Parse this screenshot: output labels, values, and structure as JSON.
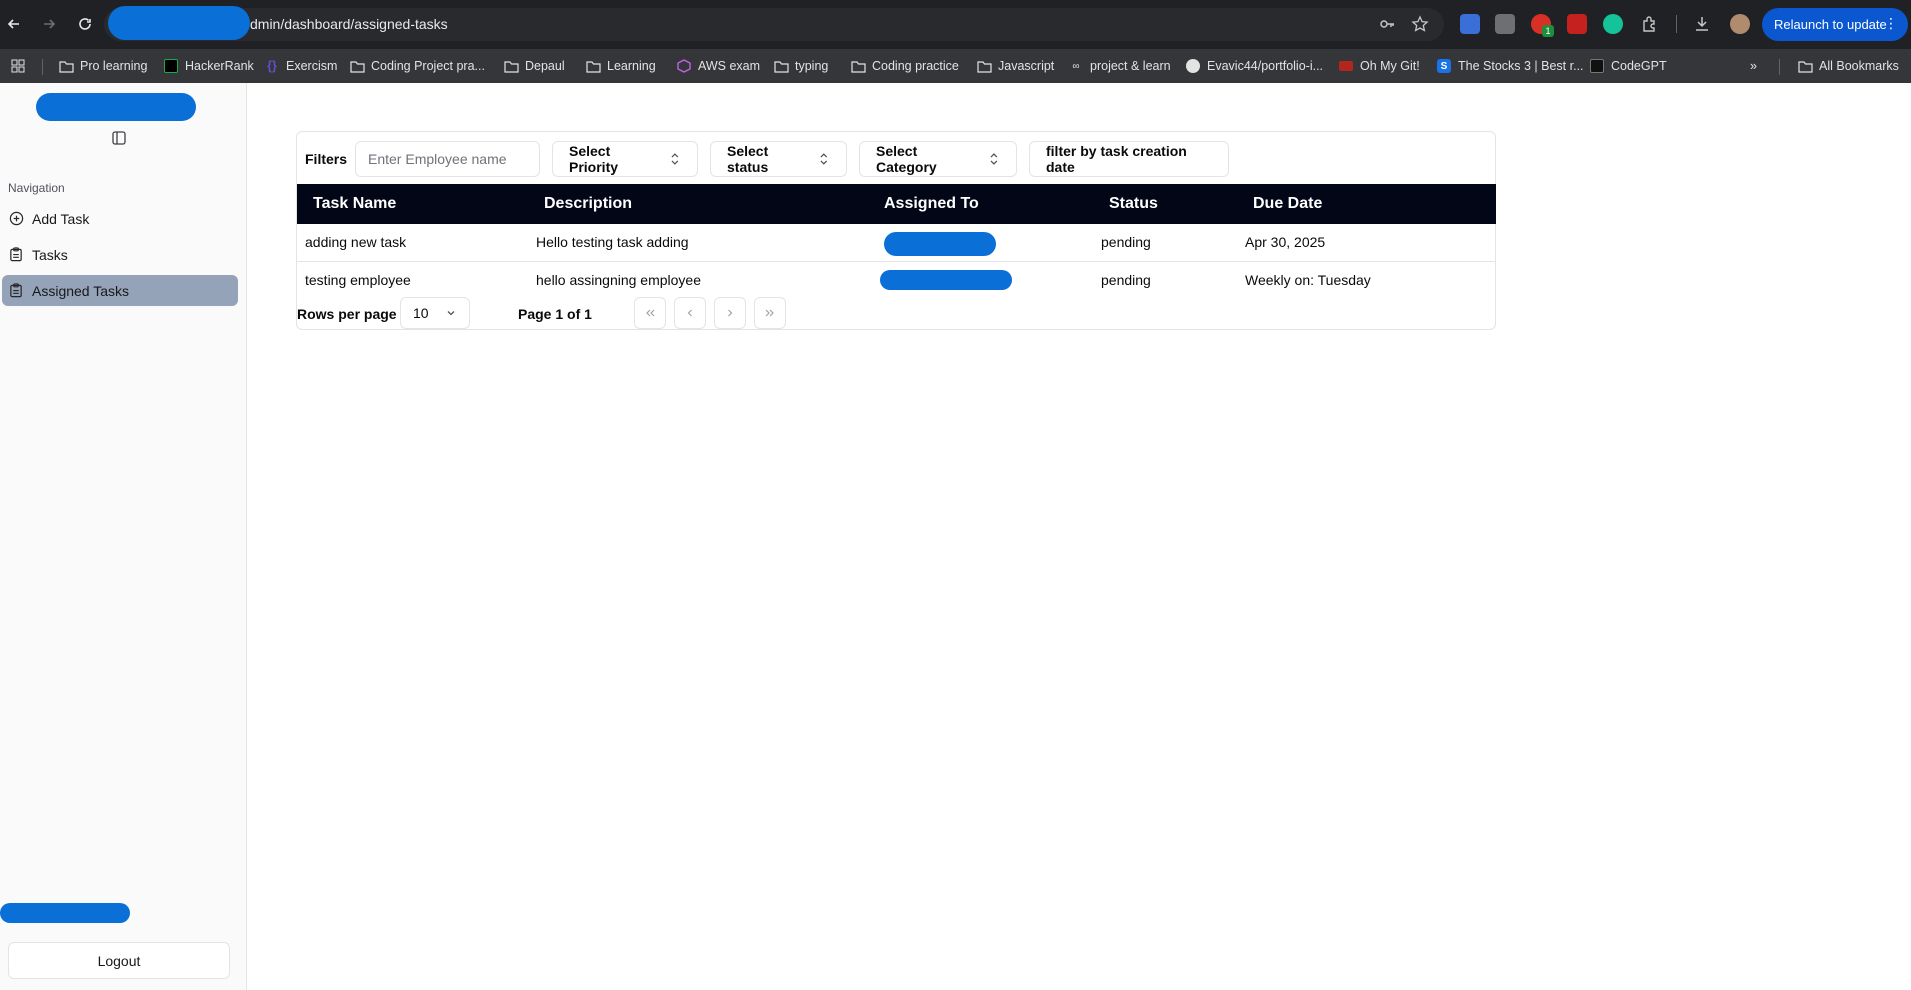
{
  "browser": {
    "url": "dmin/dashboard/assigned-tasks",
    "relaunch_label": "Relaunch to update",
    "extension_badge": "1",
    "bookmarks": [
      {
        "label": "Pro learning",
        "icon": "folder-icon"
      },
      {
        "label": "HackerRank",
        "icon": "hackerrank-icon"
      },
      {
        "label": "Exercism",
        "icon": "exercism-icon"
      },
      {
        "label": "Coding Project pra...",
        "icon": "folder-icon"
      },
      {
        "label": "Depaul",
        "icon": "folder-icon"
      },
      {
        "label": "Learning",
        "icon": "folder-icon"
      },
      {
        "label": "AWS exam",
        "icon": "aws-icon"
      },
      {
        "label": "typing",
        "icon": "folder-icon"
      },
      {
        "label": "Coding practice",
        "icon": "folder-icon"
      },
      {
        "label": "Javascript",
        "icon": "folder-icon"
      },
      {
        "label": "project & learn",
        "icon": "link-icon"
      },
      {
        "label": "Evavic44/portfolio-i...",
        "icon": "github-icon"
      },
      {
        "label": "Oh My Git!",
        "icon": "ohmygit-icon"
      },
      {
        "label": "The Stocks 3 | Best r...",
        "icon": "stocks-icon"
      },
      {
        "label": "CodeGPT",
        "icon": "codegpt-icon"
      }
    ],
    "all_bookmarks": "All Bookmarks"
  },
  "sidebar": {
    "nav_heading": "Navigation",
    "items": [
      {
        "label": "Add Task",
        "icon": "plus-circle-icon"
      },
      {
        "label": "Tasks",
        "icon": "clipboard-icon"
      },
      {
        "label": "Assigned Tasks",
        "icon": "clipboard-list-icon",
        "active": true
      }
    ],
    "logout_label": "Logout"
  },
  "filters": {
    "label": "Filters",
    "employee_placeholder": "Enter Employee name",
    "priority_label": "Select Priority",
    "status_label": "Select status",
    "category_label": "Select Category",
    "date_label": "filter by task creation date"
  },
  "table": {
    "columns": [
      "Task Name",
      "Description",
      "Assigned To",
      "Status",
      "Due Date"
    ],
    "rows": [
      {
        "task": "adding new task",
        "description": "Hello testing task adding",
        "status": "pending",
        "due": "Apr 30, 2025"
      },
      {
        "task": "testing employee",
        "description": "hello assingning employee",
        "status": "pending",
        "due": "Weekly on: Tuesday"
      }
    ]
  },
  "pagination": {
    "rows_label": "Rows per page",
    "rows_value": "10",
    "page_info": "Page 1 of 1"
  },
  "colors": {
    "table_header": "#020617",
    "active_nav": "#94a3b8",
    "redaction": "#0a6fd6",
    "relaunch": "#0b57d0"
  }
}
